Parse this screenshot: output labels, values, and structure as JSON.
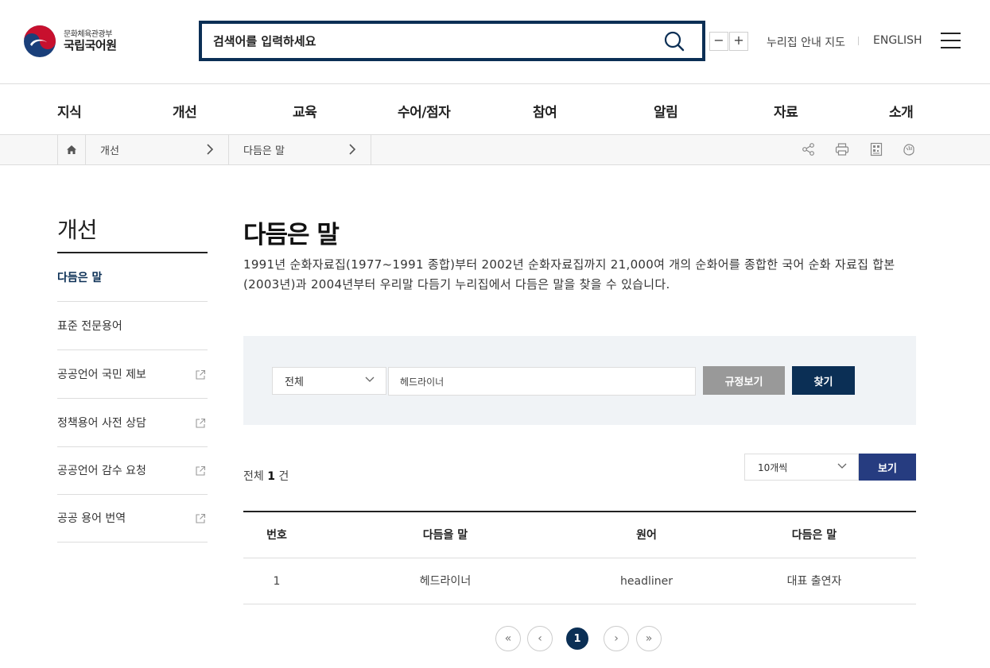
{
  "header": {
    "logo_sub": "문화체육관광부",
    "logo_main": "국립국어원",
    "search_placeholder": "검색어를 입력하세요",
    "zoom_out": "−",
    "zoom_in": "+",
    "sitemap_link": "누리집 안내 지도",
    "english_link": "ENGLISH"
  },
  "gnb": [
    "지식",
    "개선",
    "교육",
    "수어/점자",
    "참여",
    "알림",
    "자료",
    "소개"
  ],
  "breadcrumb": {
    "level1": "개선",
    "level2": "다듬은 말"
  },
  "lnb": {
    "title": "개선",
    "items": [
      {
        "label": "다듬은 말",
        "active": true,
        "external": false
      },
      {
        "label": "표준 전문용어",
        "active": false,
        "external": false
      },
      {
        "label": "공공언어 국민 제보",
        "active": false,
        "external": true
      },
      {
        "label": "정책용어 사전 상담",
        "active": false,
        "external": true
      },
      {
        "label": "공공언어 감수 요청",
        "active": false,
        "external": true
      },
      {
        "label": "공공 용어 번역",
        "active": false,
        "external": true
      }
    ]
  },
  "content": {
    "title": "다듬은 말",
    "intro": "1991년 순화자료집(1977~1991 종합)부터 2002년 순화자료집까지 21,000여 개의 순화어를 종합한 국어 순화 자료집 합본(2003년)과 2004년부터 우리말 다듬기 누리집에서 다듬은 말을 찾을 수 있습니다."
  },
  "search": {
    "scope": "전체",
    "term": "헤드라이너",
    "rule_button": "규정보기",
    "find_button": "찾기"
  },
  "list": {
    "total_prefix": "전체",
    "total_count": "1",
    "total_suffix": "건",
    "per_page": "10개씩",
    "view_button": "보기"
  },
  "table": {
    "headers": [
      "번호",
      "다듬을 말",
      "원어",
      "다듬은 말"
    ],
    "rows": [
      [
        "1",
        "헤드라이너",
        "headliner",
        "대표 출연자"
      ]
    ]
  },
  "pagination": {
    "current": "1",
    "first": "«",
    "prev": "‹",
    "next": "›",
    "last": "»"
  },
  "colors": {
    "primary": "#0b2f55",
    "view_button": "#263c80",
    "rule_button": "#999999",
    "panel_bg": "#f0f3f6"
  }
}
